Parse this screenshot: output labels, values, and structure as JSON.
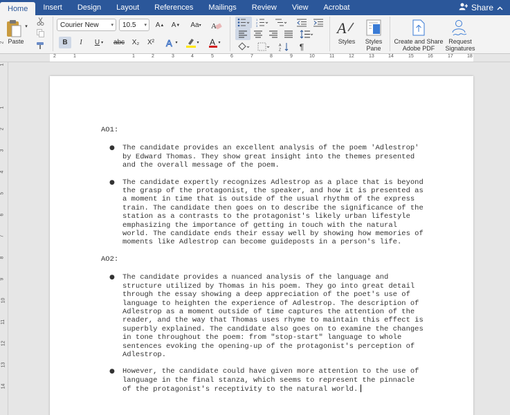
{
  "tabs": [
    {
      "label": "Home",
      "active": true
    },
    {
      "label": "Insert"
    },
    {
      "label": "Design"
    },
    {
      "label": "Layout"
    },
    {
      "label": "References"
    },
    {
      "label": "Mailings"
    },
    {
      "label": "Review"
    },
    {
      "label": "View"
    },
    {
      "label": "Acrobat"
    }
  ],
  "share_label": "Share",
  "ribbon": {
    "paste_label": "Paste",
    "font_name": "Courier New",
    "font_size": "10.5",
    "bold": "B",
    "italic": "I",
    "underline": "U",
    "strike": "abc",
    "subscript": "X₂",
    "superscript": "X²",
    "styles_label": "Styles",
    "styles_pane_label": "Styles\nPane",
    "create_share_label": "Create and Share\nAdobe PDF",
    "request_sig_label": "Request\nSignatures",
    "highlight_color": "#ffe600",
    "font_color": "#d02020",
    "accent": "#2b579a"
  },
  "ruler_numbers": [
    "2",
    "1",
    "1",
    "2",
    "3",
    "4",
    "5",
    "6",
    "7",
    "8",
    "9",
    "10",
    "11",
    "12",
    "13",
    "14",
    "15",
    "16",
    "17",
    "18"
  ],
  "vruler_numbers": [
    "2",
    "1",
    "1",
    "2",
    "3",
    "4",
    "5",
    "6",
    "7",
    "8",
    "9",
    "10",
    "11",
    "12",
    "13",
    "14"
  ],
  "document": {
    "sections": [
      {
        "heading": "AO1:",
        "bullets": [
          "The candidate provides an excellent analysis of the poem 'Adlestrop' by Edward Thomas. They show great insight into the themes presented and the overall message of the poem.",
          "The candidate expertly recognizes Adlestrop as a place that is beyond the grasp of the protagonist, the speaker, and how it is presented as a moment in time that is outside of the usual rhythm of the express train. The candidate then goes on to describe the significance of the station as a contrasts to the protagonist's likely urban lifestyle emphasizing the importance of getting in touch with the natural world. The candidate ends their essay well by showing how memories of moments like Adlestrop can become guideposts in a person's life."
        ]
      },
      {
        "heading": "AO2:",
        "bullets": [
          "The candidate provides a nuanced analysis of the language and structure utilized by Thomas in his poem. They go into great detail through the essay showing a deep appreciation of the poet's use of language to heighten the experience of Adlestrop. The description of Adlestrop as a moment outside of time captures the attention of the reader, and the way that Thomas uses rhyme to maintain this effect is superbly explained. The candidate also goes on to examine the changes in tone throughout the poem: from \"stop-start\" language to whole sentences evoking the opening-up of the protagonist's perception of Adlestrop.",
          "However, the candidate could have given more attention to the use of language in the final stanza, which seems to represent the pinnacle of the protagonist's receptivity to the natural world."
        ]
      }
    ]
  }
}
